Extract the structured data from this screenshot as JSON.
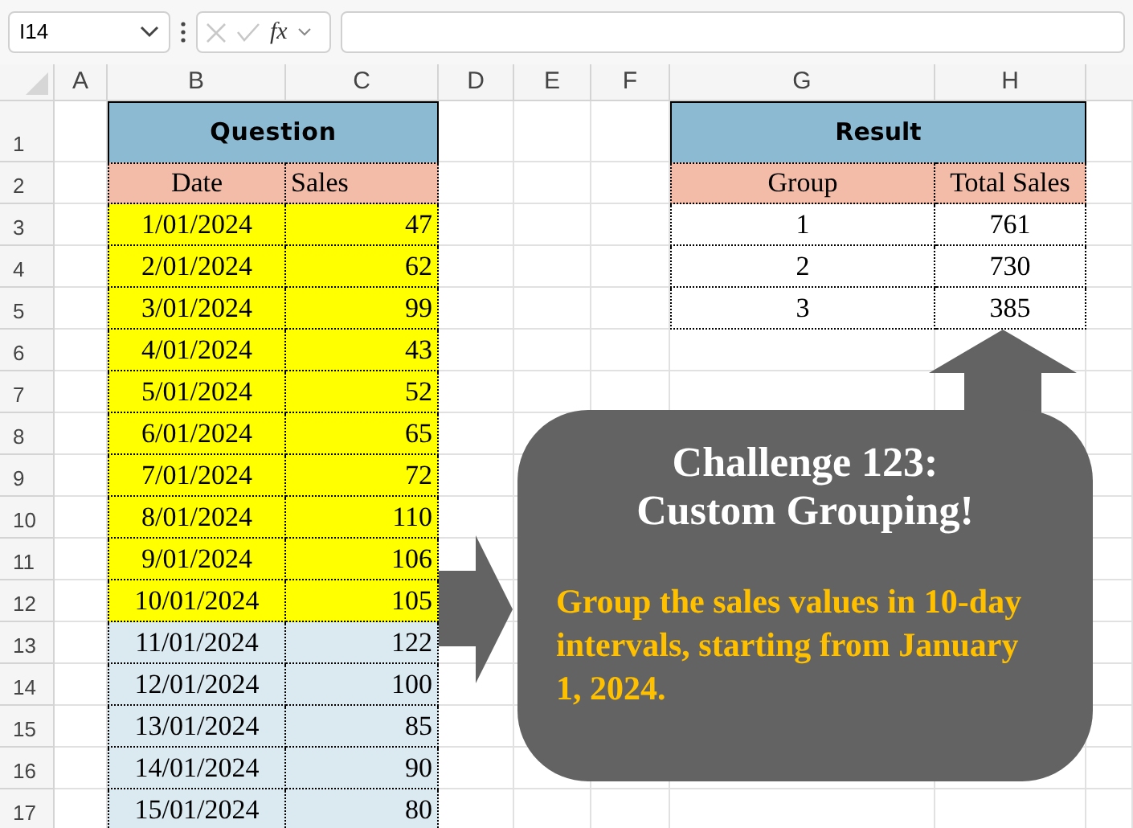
{
  "formula_bar": {
    "name_box": "I14",
    "function_label": "fx"
  },
  "column_headers": [
    "A",
    "B",
    "C",
    "D",
    "E",
    "F",
    "G",
    "H"
  ],
  "row_numbers": [
    "1",
    "2",
    "3",
    "4",
    "5",
    "6",
    "7",
    "8",
    "9",
    "10",
    "11",
    "12",
    "13",
    "14",
    "15",
    "16",
    "17"
  ],
  "question": {
    "title": "Question",
    "columns": [
      "Date",
      "Sales"
    ],
    "rows": [
      {
        "date": "1/01/2024",
        "sales": "47",
        "color": "#ffff00"
      },
      {
        "date": "2/01/2024",
        "sales": "62",
        "color": "#ffff00"
      },
      {
        "date": "3/01/2024",
        "sales": "99",
        "color": "#ffff00"
      },
      {
        "date": "4/01/2024",
        "sales": "43",
        "color": "#ffff00"
      },
      {
        "date": "5/01/2024",
        "sales": "52",
        "color": "#ffff00"
      },
      {
        "date": "6/01/2024",
        "sales": "65",
        "color": "#ffff00"
      },
      {
        "date": "7/01/2024",
        "sales": "72",
        "color": "#ffff00"
      },
      {
        "date": "8/01/2024",
        "sales": "110",
        "color": "#ffff00"
      },
      {
        "date": "9/01/2024",
        "sales": "106",
        "color": "#ffff00"
      },
      {
        "date": "10/01/2024",
        "sales": "105",
        "color": "#ffff00"
      },
      {
        "date": "11/01/2024",
        "sales": "122",
        "color": "#dbe9f1"
      },
      {
        "date": "12/01/2024",
        "sales": "100",
        "color": "#dbe9f1"
      },
      {
        "date": "13/01/2024",
        "sales": "85",
        "color": "#dbe9f1"
      },
      {
        "date": "14/01/2024",
        "sales": "90",
        "color": "#dbe9f1"
      },
      {
        "date": "15/01/2024",
        "sales": "80",
        "color": "#dbe9f1"
      }
    ]
  },
  "result": {
    "title": "Result",
    "columns": [
      "Group",
      "Total Sales"
    ],
    "rows": [
      {
        "group": "1",
        "total": "761"
      },
      {
        "group": "2",
        "total": "730"
      },
      {
        "group": "3",
        "total": "385"
      }
    ]
  },
  "callout": {
    "title_lines": [
      "Challenge 123:",
      "Custom Grouping!"
    ],
    "description": "Group the sales values in 10-day intervals, starting from January 1, 2024."
  }
}
